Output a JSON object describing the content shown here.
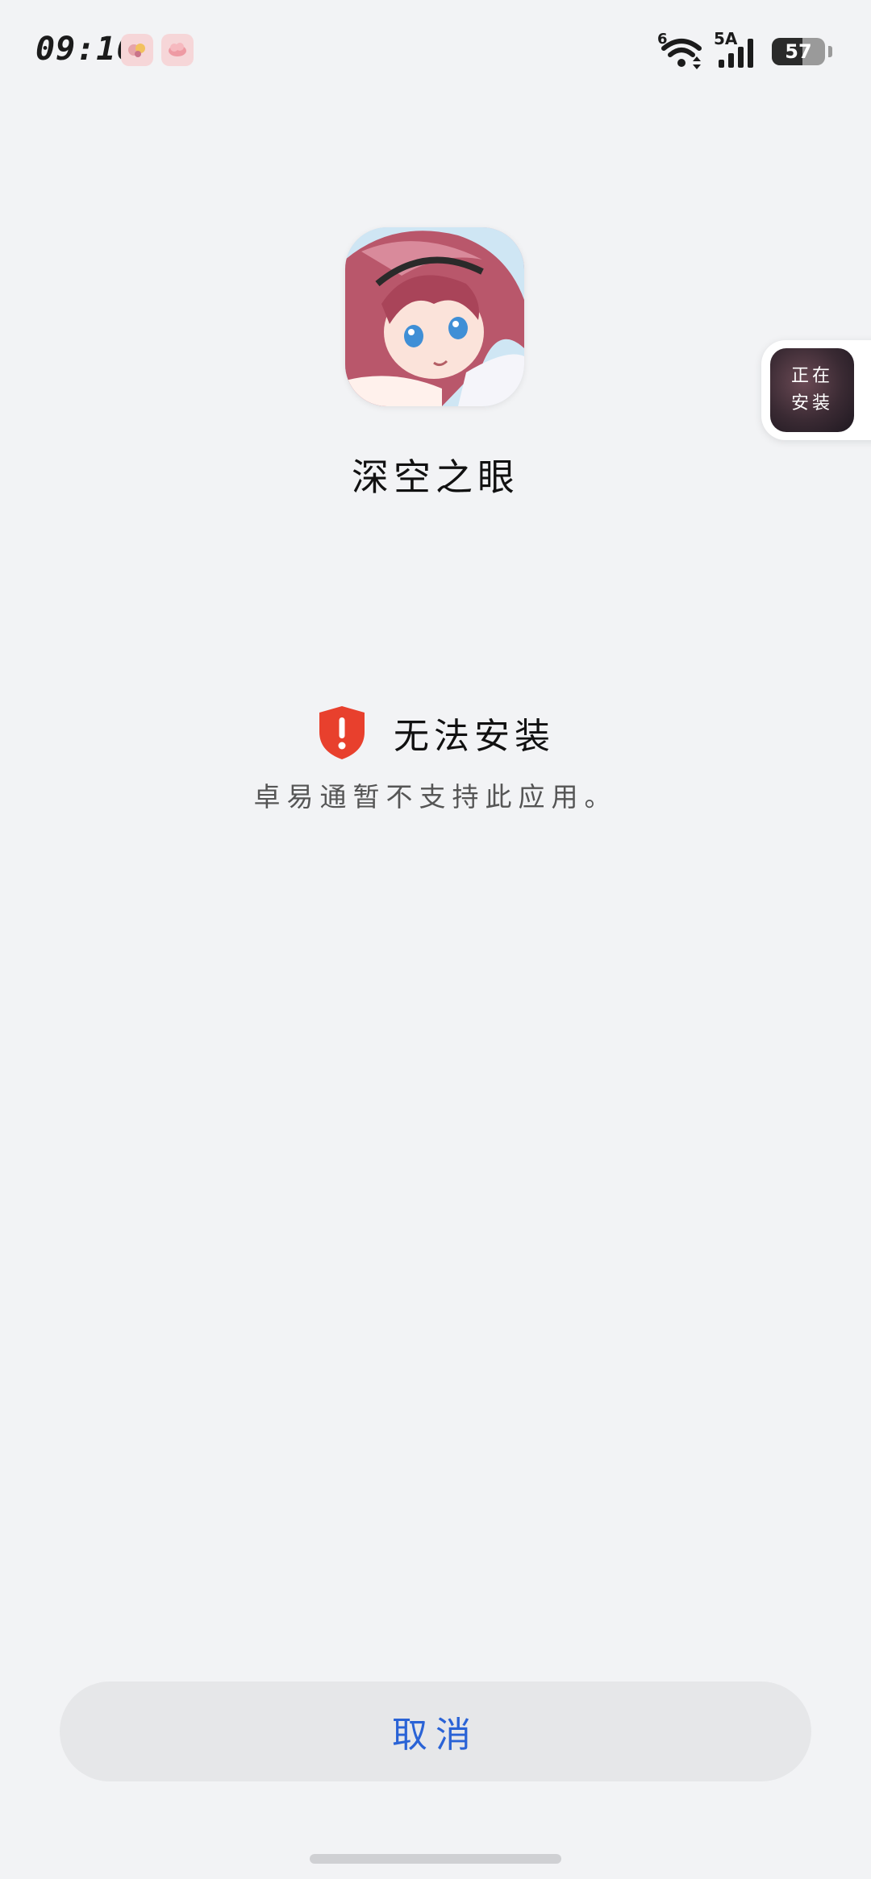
{
  "status_bar": {
    "time": "09:16",
    "notification_icons": [
      "notification-app-icon-1",
      "notification-app-icon-2"
    ],
    "wifi_label": "6",
    "signal_label": "5A",
    "battery_level": "57",
    "battery_fraction": 0.57
  },
  "app": {
    "name": "深空之眼"
  },
  "floating_widget": {
    "line1": "正在",
    "line2": "安装"
  },
  "error": {
    "title": "无法安装",
    "description": "卓易通暂不支持此应用。",
    "color": "#e8402d"
  },
  "actions": {
    "cancel_label": "取消",
    "cancel_color": "#2a63d6"
  }
}
